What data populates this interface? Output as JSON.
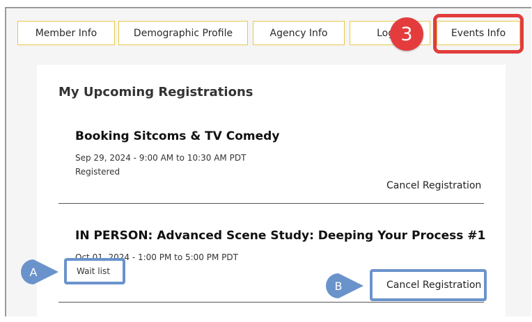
{
  "tabs": [
    {
      "label": "Member Info"
    },
    {
      "label": "Demographic Profile"
    },
    {
      "label": "Agency Info"
    },
    {
      "label": "Login"
    },
    {
      "label": "Events Info"
    }
  ],
  "annotations": {
    "step_badge": "3",
    "callout_a": "A",
    "callout_b": "B"
  },
  "section": {
    "heading": "My Upcoming Registrations"
  },
  "registrations": [
    {
      "title": "Booking Sitcoms & TV Comedy",
      "datetime": "Sep 29, 2024 - 9:00 AM to 10:30 AM PDT",
      "status": "Registered",
      "action": "Cancel Registration"
    },
    {
      "title": "IN PERSON: Advanced Scene Study: Deeping Your Process #1",
      "datetime": "Oct 01, 2024 - 1:00 PM to 5:00 PM PDT",
      "status": "Wait list",
      "action": "Cancel Registration"
    }
  ],
  "colors": {
    "tab_border": "#e8c94a",
    "highlight_red": "#e23c3c",
    "callout_blue": "#6a93cc"
  }
}
